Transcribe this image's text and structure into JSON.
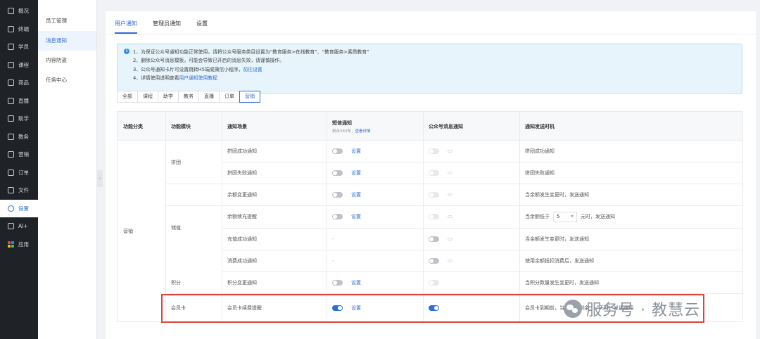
{
  "nav": [
    {
      "label": "概况",
      "icon": "grid-icon"
    },
    {
      "label": "终端",
      "icon": "monitor-icon"
    },
    {
      "label": "学员",
      "icon": "users-icon"
    },
    {
      "label": "课程",
      "icon": "play-icon"
    },
    {
      "label": "商品",
      "icon": "bag-icon"
    },
    {
      "label": "直播",
      "icon": "live-icon"
    },
    {
      "label": "助学",
      "icon": "assist-icon"
    },
    {
      "label": "教务",
      "icon": "book-icon"
    },
    {
      "label": "营销",
      "icon": "marketing-icon"
    },
    {
      "label": "订单",
      "icon": "order-icon"
    },
    {
      "label": "文件",
      "icon": "folder-icon"
    },
    {
      "label": "设置",
      "icon": "settings-icon",
      "active": true
    },
    {
      "label": "AI+",
      "icon": "ai-icon"
    },
    {
      "label": "应用",
      "icon": "apps-icon"
    }
  ],
  "subnav": [
    {
      "label": "员工管理"
    },
    {
      "label": "消息通知",
      "active": true
    },
    {
      "label": "内容防盗"
    },
    {
      "label": "任务中心"
    }
  ],
  "tabs": [
    {
      "label": "用户通知",
      "active": true
    },
    {
      "label": "管理员通知"
    },
    {
      "label": "设置"
    }
  ],
  "notice": {
    "line1": "1、为保证公众号通知功能正常使用，请将公众号服务类目设置为“教育服务>在线教育”、“教育服务>素质教育”",
    "line2": "2、删除公众号消息模板，可能会导致已开启的消息失效，请谨慎操作。",
    "line3_text": "3、公众号通知卡片可设置跳转H5端或微信小程序。",
    "line3_link": "前往设置",
    "line4_text": "4、详情使用说明查看",
    "line4_link": "用户通知使用教程"
  },
  "filters": [
    "全部",
    "课程",
    "助学",
    "教务",
    "直播",
    "订单",
    "营销"
  ],
  "active_filter": "营销",
  "table": {
    "headers": {
      "category": "功能分类",
      "module": "功能模块",
      "scene": "通知场景",
      "sms": "短信通知",
      "sms_sub": "剩余383条，",
      "sms_sub_link": "查看详情",
      "wechat": "公众号消息通知",
      "timing": "通知发送时机"
    },
    "category": "营销",
    "modules": [
      "拼团",
      "储值",
      "积分",
      "会员卡"
    ],
    "settings_label": "设置",
    "rows": [
      {
        "scene": "拼团成功通知",
        "sms": "off",
        "sms_set": true,
        "wechat": "disabled",
        "timing": "拼团成功通知"
      },
      {
        "scene": "拼团失败通知",
        "sms": "off",
        "sms_set": true,
        "wechat": "disabled",
        "timing": "拼团失败通知"
      },
      {
        "scene": "余额变更通知",
        "sms": "off",
        "sms_set": true,
        "wechat": "disabled",
        "timing": "当余额发生变更时，发送通知"
      },
      {
        "scene": "余额续充提醒",
        "sms": "off",
        "sms_set": true,
        "wechat": "disabled",
        "timing_pre": "当余额低于",
        "timing_value": "5",
        "timing_post": "元时，发送通知"
      },
      {
        "scene": "充值成功通知",
        "sms": "none",
        "wechat": "off",
        "timing": "当余额发生变更时，发送通知"
      },
      {
        "scene": "消费成功通知",
        "sms": "none",
        "wechat": "off",
        "timing": "使用余额抵扣消费后，发送通知"
      },
      {
        "scene": "积分变更通知",
        "sms": "off",
        "sms_set": true,
        "wechat": "disabled_plain",
        "timing": "当积分数量发生变更时，发送通知"
      },
      {
        "scene": "会员卡续费提醒",
        "sms": "on",
        "sms_set": true,
        "wechat": "on",
        "timing": "会员卡到期前，当有效期剩余",
        "timing_tail": "天时，发送通知"
      }
    ],
    "dash": "-"
  },
  "watermark": "服务号 · 教慧云",
  "colors": {
    "primary": "#2d6ed8",
    "nav_bg": "#1f2227",
    "highlight": "#d9463b",
    "notice_bg": "#e7f4fc"
  }
}
